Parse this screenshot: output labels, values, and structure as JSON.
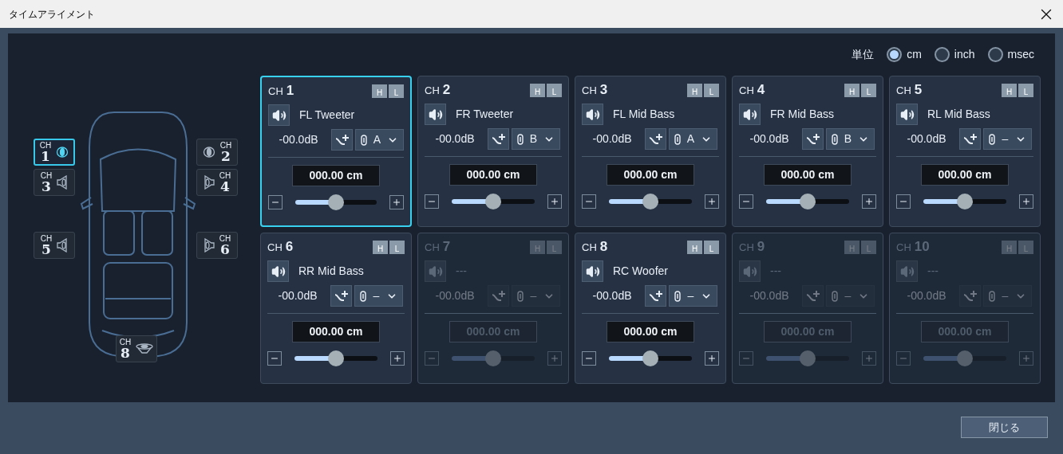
{
  "window": {
    "title": "タイムアライメント"
  },
  "units": {
    "label": "単位",
    "options": [
      {
        "label": "cm",
        "selected": true
      },
      {
        "label": "inch",
        "selected": false
      },
      {
        "label": "msec",
        "selected": false
      }
    ]
  },
  "car_channels": [
    {
      "prefix": "CH",
      "number": "1",
      "kind": "tweeter",
      "selected": true
    },
    {
      "prefix": "CH",
      "number": "2",
      "kind": "tweeter",
      "selected": false
    },
    {
      "prefix": "CH",
      "number": "3",
      "kind": "midbass",
      "selected": false
    },
    {
      "prefix": "CH",
      "number": "4",
      "kind": "midbass",
      "selected": false
    },
    {
      "prefix": "CH",
      "number": "5",
      "kind": "midbass",
      "selected": false
    },
    {
      "prefix": "CH",
      "number": "6",
      "kind": "midbass",
      "selected": false
    },
    {
      "prefix": "CH",
      "number": "8",
      "kind": "woofer",
      "selected": false
    }
  ],
  "channels": [
    {
      "prefix": "CH",
      "number": "1",
      "hpf": "H",
      "lpf": "L",
      "name": "FL Tweeter",
      "gain": "-00.0dB",
      "link": "A",
      "distance": "000.00 cm",
      "level": 0.5,
      "enabled": true,
      "selected": true
    },
    {
      "prefix": "CH",
      "number": "2",
      "hpf": "H",
      "lpf": "L",
      "name": "FR Tweeter",
      "gain": "-00.0dB",
      "link": "B",
      "distance": "000.00 cm",
      "level": 0.5,
      "enabled": true,
      "selected": false
    },
    {
      "prefix": "CH",
      "number": "3",
      "hpf": "H",
      "lpf": "L",
      "name": "FL Mid Bass",
      "gain": "-00.0dB",
      "link": "A",
      "distance": "000.00 cm",
      "level": 0.5,
      "enabled": true,
      "selected": false
    },
    {
      "prefix": "CH",
      "number": "4",
      "hpf": "H",
      "lpf": "L",
      "name": "FR Mid Bass",
      "gain": "-00.0dB",
      "link": "B",
      "distance": "000.00 cm",
      "level": 0.5,
      "enabled": true,
      "selected": false
    },
    {
      "prefix": "CH",
      "number": "5",
      "hpf": "H",
      "lpf": "L",
      "name": "RL Mid Bass",
      "gain": "-00.0dB",
      "link": "–",
      "distance": "000.00 cm",
      "level": 0.5,
      "enabled": true,
      "selected": false
    },
    {
      "prefix": "CH",
      "number": "6",
      "hpf": "H",
      "lpf": "L",
      "name": "RR Mid Bass",
      "gain": "-00.0dB",
      "link": "–",
      "distance": "000.00 cm",
      "level": 0.5,
      "enabled": true,
      "selected": false
    },
    {
      "prefix": "CH",
      "number": "7",
      "hpf": "H",
      "lpf": "L",
      "name": "---",
      "gain": "-00.0dB",
      "link": "–",
      "distance": "000.00 cm",
      "level": 0.5,
      "enabled": false,
      "selected": false
    },
    {
      "prefix": "CH",
      "number": "8",
      "hpf": "H",
      "lpf": "L",
      "name": "RC Woofer",
      "gain": "-00.0dB",
      "link": "–",
      "distance": "000.00 cm",
      "level": 0.5,
      "enabled": true,
      "selected": false
    },
    {
      "prefix": "CH",
      "number": "9",
      "hpf": "H",
      "lpf": "L",
      "name": "---",
      "gain": "-00.0dB",
      "link": "–",
      "distance": "000.00 cm",
      "level": 0.5,
      "enabled": false,
      "selected": false
    },
    {
      "prefix": "CH",
      "number": "10",
      "hpf": "H",
      "lpf": "L",
      "name": "---",
      "gain": "-00.0dB",
      "link": "–",
      "distance": "000.00 cm",
      "level": 0.5,
      "enabled": false,
      "selected": false
    }
  ],
  "buttons": {
    "close": "閉じる"
  }
}
